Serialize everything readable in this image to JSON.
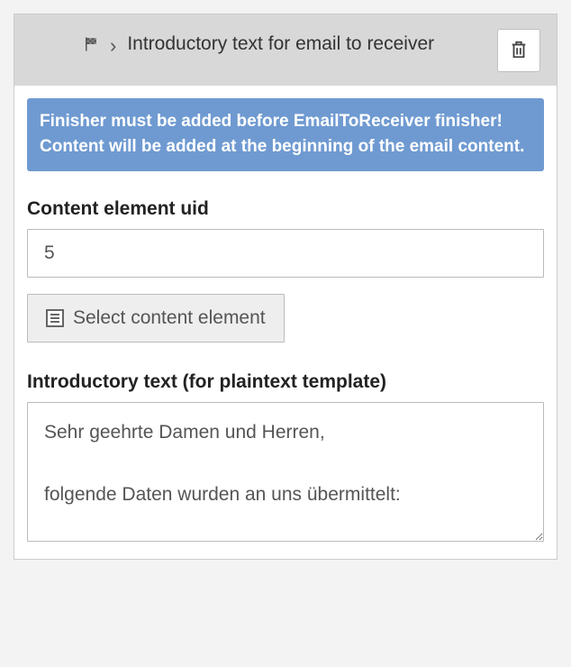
{
  "header": {
    "title": "Introductory text for email to receiver"
  },
  "info": {
    "message": "Finisher must be added before EmailToReceiver finisher! Content will be added at the beginning of the email content."
  },
  "fields": {
    "uid": {
      "label": "Content element uid",
      "value": "5"
    },
    "selectBtn": {
      "label": "Select content element"
    },
    "introText": {
      "label": "Introductory text (for plaintext template)",
      "value": "Sehr geehrte Damen und Herren,\n\nfolgende Daten wurden an uns übermittelt:"
    }
  }
}
